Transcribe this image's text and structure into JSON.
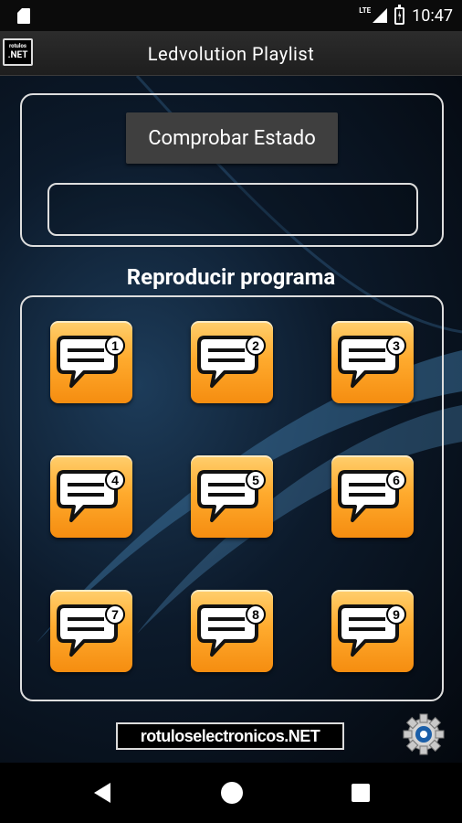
{
  "status_bar": {
    "network": "LTE",
    "time": "10:47"
  },
  "app_bar": {
    "logo_line1": "rotulos",
    "logo_line2": ".NET",
    "title": "Ledvolution Playlist"
  },
  "status_section": {
    "check_button_label": "Comprobar Estado",
    "status_value": ""
  },
  "program_section": {
    "heading": "Reproducir programa",
    "programs": [
      {
        "number": "1"
      },
      {
        "number": "2"
      },
      {
        "number": "3"
      },
      {
        "number": "4"
      },
      {
        "number": "5"
      },
      {
        "number": "6"
      },
      {
        "number": "7"
      },
      {
        "number": "8"
      },
      {
        "number": "9"
      }
    ]
  },
  "footer": {
    "brand_logo": "rotuloselectronicos.NET",
    "settings_icon": "gear-icon"
  },
  "colors": {
    "accent_orange": "#ffab2e",
    "background_dark": "#0c1a2b",
    "swoosh_blue": "#3a6f99"
  },
  "nav_bar": {
    "icons": [
      "back-icon",
      "home-icon",
      "recents-icon"
    ]
  }
}
